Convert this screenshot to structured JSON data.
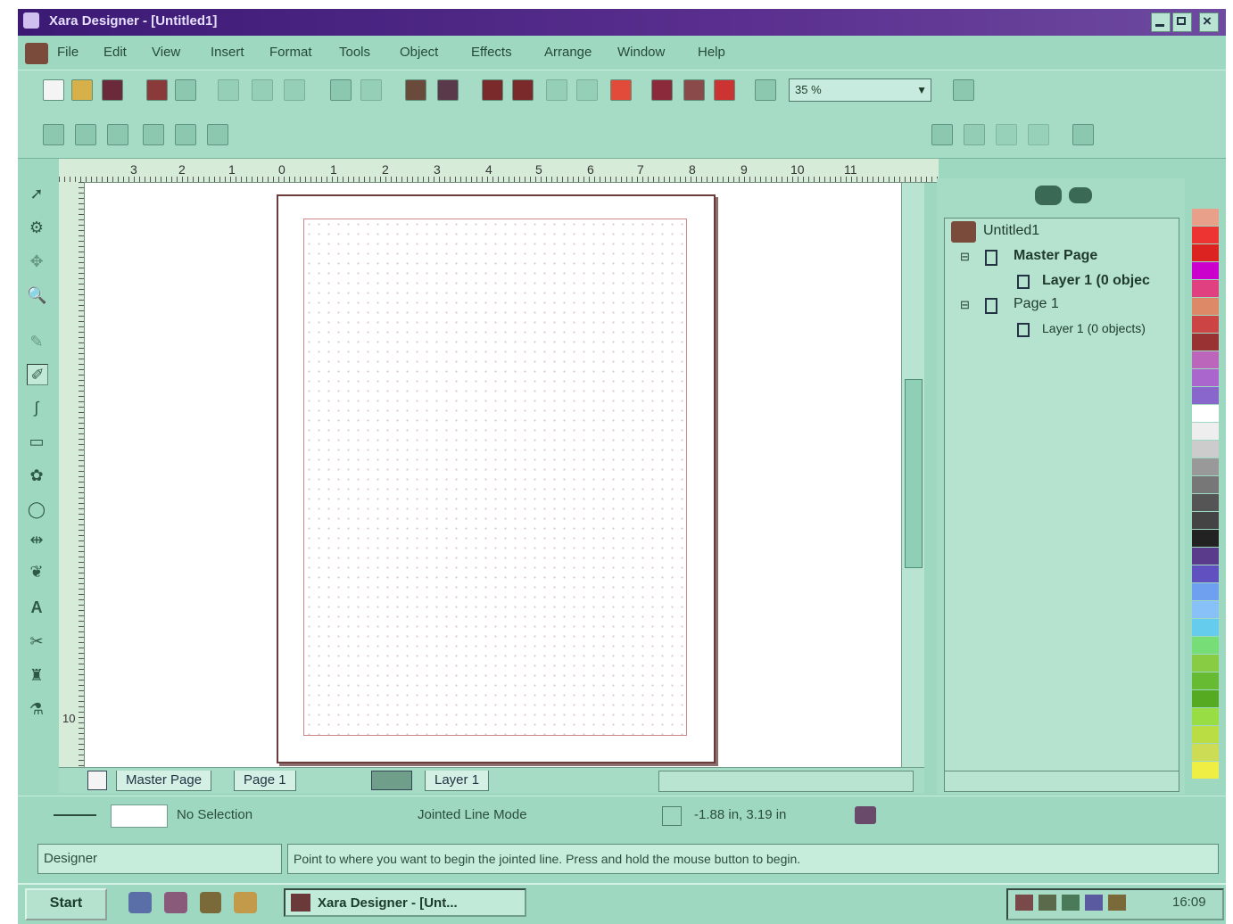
{
  "window": {
    "title": "Xara Designer - [Untitled1]"
  },
  "menu": [
    "File",
    "Edit",
    "View",
    "Insert",
    "Format",
    "Tools",
    "Object",
    "Effects",
    "Arrange",
    "Window",
    "Help"
  ],
  "toolbar": {
    "zoom_value": "35 %"
  },
  "rulers": {
    "h_labels": [
      "3",
      "2",
      "1",
      "0",
      "1",
      "2",
      "3",
      "4",
      "5",
      "6",
      "7",
      "8",
      "9",
      "10",
      "11"
    ],
    "v_labels": [
      "10"
    ]
  },
  "tabs": {
    "master": "Master Page",
    "page1": "Page 1",
    "layer": "Layer 1"
  },
  "tree": {
    "root": "Untitled1",
    "master": "Master Page",
    "master_layer": "Layer 1 (0 objec",
    "page": "Page 1",
    "page_layer": "Layer 1 (0 objects)"
  },
  "status": {
    "selection": "No Selection",
    "mode": "Jointed Line Mode",
    "coords": "-1.88 in, 3.19 in"
  },
  "hint": {
    "left": "Designer",
    "message": "Point to where you want to begin the jointed line. Press and hold the mouse button to begin."
  },
  "taskbar": {
    "start": "Start",
    "app_button": "Xara Designer - [Unt...",
    "clock": "16:09"
  },
  "palette_colors": [
    "#e8a08a",
    "#e33",
    "#d22",
    "#c0c",
    "#e04080",
    "#d86",
    "#c44",
    "#933",
    "#b6b",
    "#a6c",
    "#86c",
    "#fff",
    "#eee",
    "#ccc",
    "#999",
    "#777",
    "#555",
    "#444",
    "#222",
    "#5a3a8a",
    "#6050c0",
    "#6fa0f0",
    "#88c0f8",
    "#6ce",
    "#7d7",
    "#8c4",
    "#6b3",
    "#5a2",
    "#9d4",
    "#bd4",
    "#cd5",
    "#ee4"
  ]
}
